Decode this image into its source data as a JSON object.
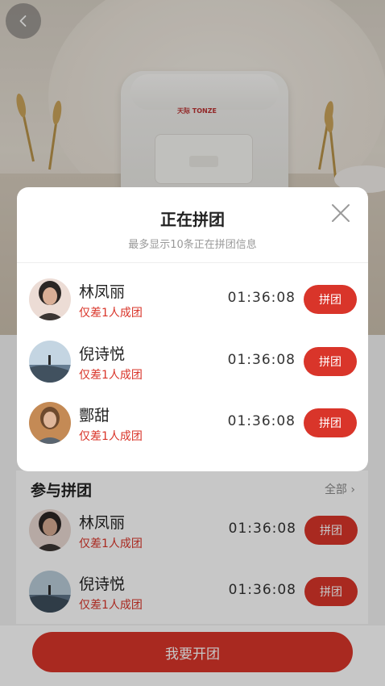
{
  "hero": {
    "brand_text": "天际 TONZE"
  },
  "nav": {
    "back_icon": "chevron-left-icon"
  },
  "join_section": {
    "title": "参与拼团",
    "all_label": "全部 ›",
    "items": [
      {
        "name": "林凤丽",
        "tip": "仅差1人成团",
        "timer": "01:36:08",
        "button": "拼团"
      },
      {
        "name": "倪诗悦",
        "tip": "仅差1人成团",
        "timer": "01:36:08",
        "button": "拼团"
      }
    ]
  },
  "bottom": {
    "open_button": "我要开团"
  },
  "modal": {
    "title": "正在拼团",
    "subtitle": "最多显示10条正在拼团信息",
    "close_icon": "close-icon",
    "items": [
      {
        "name": "林凤丽",
        "tip": "仅差1人成团",
        "timer": "01:36:08",
        "button": "拼团"
      },
      {
        "name": "倪诗悦",
        "tip": "仅差1人成团",
        "timer": "01:36:08",
        "button": "拼团"
      },
      {
        "name": "酆甜",
        "tip": "仅差1人成团",
        "timer": "01:36:08",
        "button": "拼团"
      }
    ]
  },
  "colors": {
    "accent": "#d9352a",
    "mask": "rgba(0,0,0,0.22)"
  }
}
